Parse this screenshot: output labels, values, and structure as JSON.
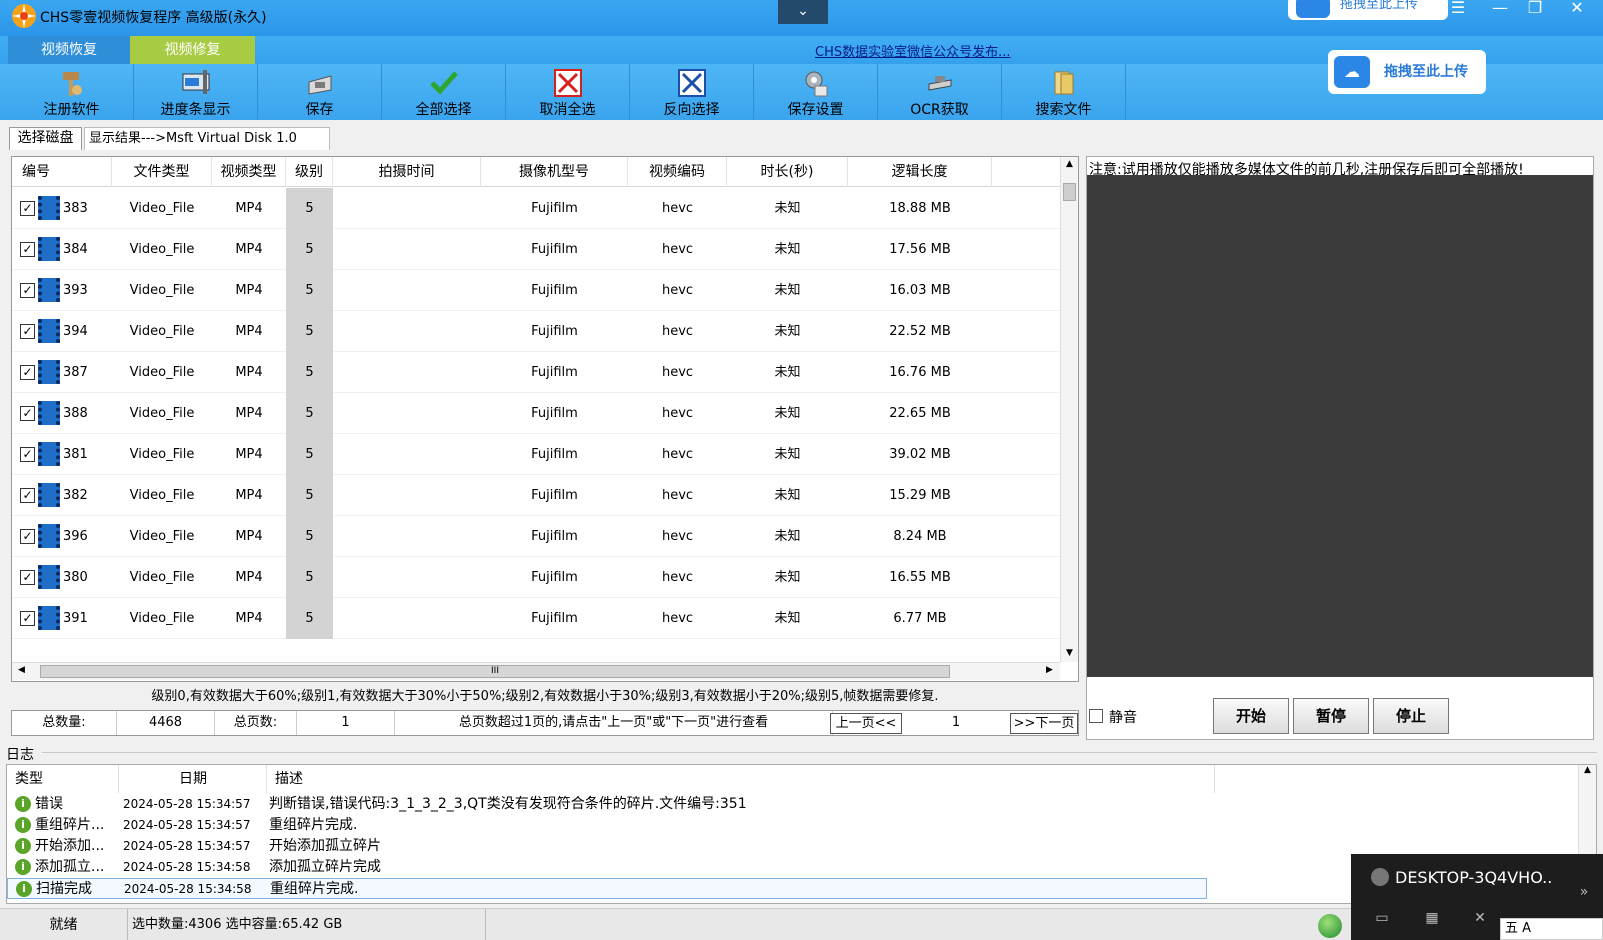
{
  "window": {
    "title": "CHS零壹视频恢复程序 高级版(永久)",
    "collapse_glyph": "⌄",
    "upload_top_label": "拖拽至此上传",
    "controls": {
      "menu": "☰",
      "minimize": "—",
      "restore": "❐",
      "close": "✕"
    }
  },
  "main_tabs": [
    "视频恢复",
    "视频修复"
  ],
  "notice_link": "CHS数据实验室微信公众号发布...",
  "toolbar": [
    {
      "label": "注册软件",
      "icon": "key-icon"
    },
    {
      "label": "进度条显示",
      "icon": "progress-icon"
    },
    {
      "label": "保存",
      "icon": "save-icon"
    },
    {
      "label": "全部选择",
      "icon": "check-icon"
    },
    {
      "label": "取消全选",
      "icon": "cancel-icon"
    },
    {
      "label": "反向选择",
      "icon": "invert-icon"
    },
    {
      "label": "保存设置",
      "icon": "settings-icon"
    },
    {
      "label": "OCR获取",
      "icon": "ocr-icon"
    },
    {
      "label": "搜索文件",
      "icon": "search-file-icon"
    }
  ],
  "upload_main_label": "拖拽至此上传",
  "sub_tabs": {
    "disk": "选择磁盘",
    "result": "显示结果--->Msft   Virtual Disk    1.0"
  },
  "table": {
    "columns": [
      "编号",
      "文件类型",
      "视频类型",
      "级别",
      "拍摄时间",
      "摄像机型号",
      "视频编码",
      "时长(秒)",
      "逻辑长度"
    ],
    "rows": [
      {
        "id": "383",
        "file_type": "Video_File",
        "video_type": "MP4",
        "level": "5",
        "time": "",
        "camera": "Fujifilm",
        "codec": "hevc",
        "duration": "未知",
        "size": "18.88 MB"
      },
      {
        "id": "384",
        "file_type": "Video_File",
        "video_type": "MP4",
        "level": "5",
        "time": "",
        "camera": "Fujifilm",
        "codec": "hevc",
        "duration": "未知",
        "size": "17.56 MB"
      },
      {
        "id": "393",
        "file_type": "Video_File",
        "video_type": "MP4",
        "level": "5",
        "time": "",
        "camera": "Fujifilm",
        "codec": "hevc",
        "duration": "未知",
        "size": "16.03 MB"
      },
      {
        "id": "394",
        "file_type": "Video_File",
        "video_type": "MP4",
        "level": "5",
        "time": "",
        "camera": "Fujifilm",
        "codec": "hevc",
        "duration": "未知",
        "size": "22.52 MB"
      },
      {
        "id": "387",
        "file_type": "Video_File",
        "video_type": "MP4",
        "level": "5",
        "time": "",
        "camera": "Fujifilm",
        "codec": "hevc",
        "duration": "未知",
        "size": "16.76 MB"
      },
      {
        "id": "388",
        "file_type": "Video_File",
        "video_type": "MP4",
        "level": "5",
        "time": "",
        "camera": "Fujifilm",
        "codec": "hevc",
        "duration": "未知",
        "size": "22.65 MB"
      },
      {
        "id": "381",
        "file_type": "Video_File",
        "video_type": "MP4",
        "level": "5",
        "time": "",
        "camera": "Fujifilm",
        "codec": "hevc",
        "duration": "未知",
        "size": "39.02 MB"
      },
      {
        "id": "382",
        "file_type": "Video_File",
        "video_type": "MP4",
        "level": "5",
        "time": "",
        "camera": "Fujifilm",
        "codec": "hevc",
        "duration": "未知",
        "size": "15.29 MB"
      },
      {
        "id": "396",
        "file_type": "Video_File",
        "video_type": "MP4",
        "level": "5",
        "time": "",
        "camera": "Fujifilm",
        "codec": "hevc",
        "duration": "未知",
        "size": "8.24 MB"
      },
      {
        "id": "380",
        "file_type": "Video_File",
        "video_type": "MP4",
        "level": "5",
        "time": "",
        "camera": "Fujifilm",
        "codec": "hevc",
        "duration": "未知",
        "size": "16.55 MB"
      },
      {
        "id": "391",
        "file_type": "Video_File",
        "video_type": "MP4",
        "level": "5",
        "time": "",
        "camera": "Fujifilm",
        "codec": "hevc",
        "duration": "未知",
        "size": "6.77 MB"
      }
    ],
    "row_checked": true,
    "hscroll_grip": "III"
  },
  "level_info": "级别0,有效数据大于60%;级别1,有效数据大于30%小于50%;级别2,有效数据小于30%;级别3,有效数据小于20%;级别5,帧数据需要修复.",
  "pager": {
    "total_label": "总数量:",
    "total_value": "4468",
    "pages_label": "总页数:",
    "pages_value": "1",
    "hint": "总页数超过1页的,请点击\"上一页\"或\"下一页\"进行查看",
    "prev_label": "上一页<<",
    "current_page": "1",
    "next_label": ">>下一页"
  },
  "preview": {
    "note": "注意:试用播放仅能播放多媒体文件的前几秒,注册保存后即可全部播放!",
    "mute_label": "静音",
    "start_label": "开始",
    "pause_label": "暂停",
    "stop_label": "停止"
  },
  "log": {
    "title": "日志",
    "columns": [
      "类型",
      "日期",
      "描述"
    ],
    "rows": [
      {
        "type": "错误",
        "date": "2024-05-28 15:34:57",
        "desc": "判断错误,错误代码:3_1_3_2_3,QT类没有发现符合条件的碎片.文件编号:351"
      },
      {
        "type": "重组碎片...",
        "date": "2024-05-28 15:34:57",
        "desc": "重组碎片完成."
      },
      {
        "type": "开始添加...",
        "date": "2024-05-28 15:34:57",
        "desc": "开始添加孤立碎片"
      },
      {
        "type": "添加孤立...",
        "date": "2024-05-28 15:34:58",
        "desc": "添加孤立碎片完成"
      },
      {
        "type": "扫描完成",
        "date": "2024-05-28 15:34:58",
        "desc": "重组碎片完成."
      }
    ],
    "selected_index": 4
  },
  "status": {
    "ready": "就绪",
    "selection": "选中数量:4306 选中容量:65.42 GB"
  },
  "remote": {
    "machine": "DESKTOP-3Q4VHO..",
    "ime": "五 A"
  },
  "colors": {
    "title_bar": "#2b95e8",
    "repair_tab": "#a7cb43",
    "level_cell": "#d3d3d3",
    "log_info_icon": "#5aa428"
  }
}
